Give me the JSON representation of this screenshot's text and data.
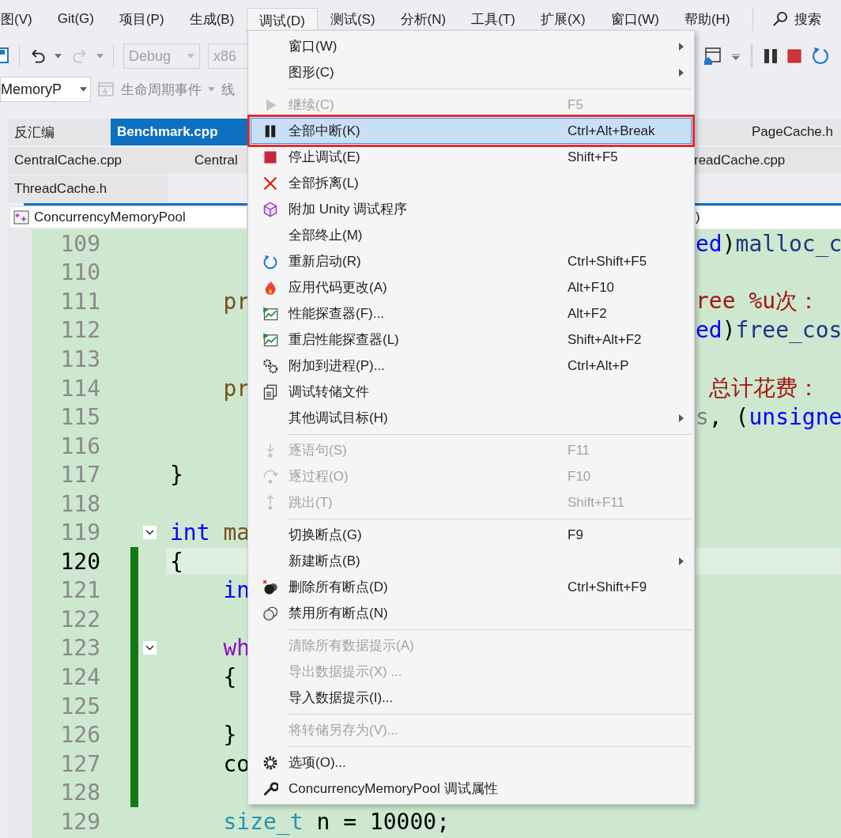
{
  "menu_bar": [
    {
      "label": "图(V)",
      "selected": false
    },
    {
      "label": "Git(G)",
      "selected": false
    },
    {
      "label": "项目(P)",
      "selected": false
    },
    {
      "label": "生成(B)",
      "selected": false
    },
    {
      "label": "调试(D)",
      "selected": true
    },
    {
      "label": "测试(S)",
      "selected": false
    },
    {
      "label": "分析(N)",
      "selected": false
    },
    {
      "label": "工具(T)",
      "selected": false
    },
    {
      "label": "扩展(X)",
      "selected": false
    },
    {
      "label": "窗口(W)",
      "selected": false
    },
    {
      "label": "帮助(H)",
      "selected": false
    }
  ],
  "search": {
    "label": "搜索"
  },
  "toolbar": {
    "configuration": "Debug",
    "platform": "x86"
  },
  "context_bar": {
    "project": "MemoryP",
    "lifecycle": "生命周期事件",
    "thread": "线"
  },
  "tab_rows": [
    {
      "left": [
        {
          "label": "反汇编",
          "selected": false
        },
        {
          "label": "Benchmark.cpp",
          "selected": true
        }
      ],
      "right": [
        {
          "label": "PageCache.h",
          "selected": false
        }
      ]
    },
    {
      "left": [
        {
          "label": "CentralCache.cpp",
          "selected": false
        },
        {
          "label": "Central",
          "selected": false
        }
      ],
      "right": [
        {
          "label": "readCache.cpp",
          "selected": false
        }
      ]
    },
    {
      "left": [
        {
          "label": "ThreadCache.h",
          "selected": false
        }
      ]
    }
  ],
  "nav_bar": {
    "scope": "ConcurrencyMemoryPool",
    "member": ")"
  },
  "lines": [
    {
      "number": "109",
      "current": false,
      "changed": false,
      "foldable": false,
      "right": [
        {
          "text": "ed",
          "kind": "keyword"
        },
        {
          "text": ")",
          "kind": "plain"
        },
        {
          "text": "malloc_c",
          "kind": "variable"
        }
      ]
    },
    {
      "number": "110",
      "current": false,
      "changed": false,
      "foldable": false
    },
    {
      "number": "111",
      "current": false,
      "changed": false,
      "foldable": false,
      "left": [
        {
          "text": "    pr",
          "kind": "function"
        }
      ],
      "right": [
        {
          "text": "ree %u次：",
          "kind": "string"
        }
      ]
    },
    {
      "number": "112",
      "current": false,
      "changed": false,
      "foldable": false,
      "right": [
        {
          "text": "ed",
          "kind": "keyword"
        },
        {
          "text": ")",
          "kind": "plain"
        },
        {
          "text": "free_cos",
          "kind": "variable"
        }
      ]
    },
    {
      "number": "113",
      "current": false,
      "changed": false,
      "foldable": false
    },
    {
      "number": "114",
      "current": false,
      "changed": false,
      "foldable": false,
      "left": [
        {
          "text": "    pr",
          "kind": "function"
        }
      ],
      "right": [
        {
          "text": " 总计花费：",
          "kind": "string"
        }
      ]
    },
    {
      "number": "115",
      "current": false,
      "changed": false,
      "foldable": false,
      "right": [
        {
          "text": "s",
          "kind": "param"
        },
        {
          "text": ", (",
          "kind": "plain"
        },
        {
          "text": "unsigne",
          "kind": "keyword"
        }
      ]
    },
    {
      "number": "116",
      "current": false,
      "changed": false,
      "foldable": false
    },
    {
      "number": "117",
      "current": false,
      "changed": false,
      "foldable": false,
      "left": [
        {
          "text": "}",
          "kind": "plain"
        }
      ]
    },
    {
      "number": "118",
      "current": false,
      "changed": false,
      "foldable": false
    },
    {
      "number": "119",
      "current": false,
      "changed": false,
      "foldable": true,
      "left": [
        {
          "text": "int",
          "kind": "keyword"
        },
        {
          "text": " ma",
          "kind": "function"
        }
      ]
    },
    {
      "number": "120",
      "current": true,
      "changed": true,
      "foldable": false,
      "left": [
        {
          "text": "{",
          "kind": "plain"
        }
      ]
    },
    {
      "number": "121",
      "current": false,
      "changed": true,
      "foldable": false,
      "left": [
        {
          "text": "    in",
          "kind": "keyword"
        }
      ]
    },
    {
      "number": "122",
      "current": false,
      "changed": true,
      "foldable": false
    },
    {
      "number": "123",
      "current": false,
      "changed": true,
      "foldable": true,
      "left": [
        {
          "text": "    wh",
          "kind": "control"
        }
      ]
    },
    {
      "number": "124",
      "current": false,
      "changed": true,
      "foldable": false,
      "left": [
        {
          "text": "    {",
          "kind": "plain"
        }
      ]
    },
    {
      "number": "125",
      "current": false,
      "changed": true,
      "foldable": false
    },
    {
      "number": "126",
      "current": false,
      "changed": true,
      "foldable": false,
      "left": [
        {
          "text": "    }",
          "kind": "plain"
        }
      ]
    },
    {
      "number": "127",
      "current": false,
      "changed": true,
      "foldable": false,
      "left": [
        {
          "text": "    co",
          "kind": "plain"
        }
      ]
    },
    {
      "number": "128",
      "current": false,
      "changed": true,
      "foldable": false
    },
    {
      "number": "129",
      "current": false,
      "changed": false,
      "foldable": false,
      "left": [
        {
          "text": "    size_t",
          "kind": "type"
        },
        {
          "text": " n = 10000;",
          "kind": "plain"
        }
      ]
    }
  ],
  "menu": [
    {
      "kind": "item",
      "label": "窗口(W)",
      "disabled": false,
      "submenu": true,
      "selected": false
    },
    {
      "kind": "item",
      "label": "图形(C)",
      "disabled": false,
      "submenu": true,
      "selected": false
    },
    {
      "kind": "separator"
    },
    {
      "kind": "item",
      "label": "继续(C)",
      "shortcut": "F5",
      "disabled": true,
      "submenu": false,
      "selected": false
    },
    {
      "kind": "item",
      "label": "全部中断(K)",
      "shortcut": "Ctrl+Alt+Break",
      "disabled": false,
      "submenu": false,
      "selected": true
    },
    {
      "kind": "item",
      "label": "停止调试(E)",
      "shortcut": "Shift+F5",
      "disabled": false,
      "submenu": false,
      "selected": false
    },
    {
      "kind": "item",
      "label": "全部拆离(L)",
      "disabled": false,
      "submenu": false,
      "selected": false
    },
    {
      "kind": "item",
      "label": "附加 Unity 调试程序",
      "disabled": false,
      "submenu": false,
      "selected": false
    },
    {
      "kind": "item",
      "label": "全部终止(M)",
      "disabled": false,
      "submenu": false,
      "selected": false
    },
    {
      "kind": "item",
      "label": "重新启动(R)",
      "shortcut": "Ctrl+Shift+F5",
      "disabled": false,
      "submenu": false,
      "selected": false
    },
    {
      "kind": "item",
      "label": "应用代码更改(A)",
      "shortcut": "Alt+F10",
      "disabled": false,
      "submenu": false,
      "selected": false
    },
    {
      "kind": "item",
      "label": "性能探查器(F)...",
      "shortcut": "Alt+F2",
      "disabled": false,
      "submenu": false,
      "selected": false
    },
    {
      "kind": "item",
      "label": "重启性能探查器(L)",
      "shortcut": "Shift+Alt+F2",
      "disabled": false,
      "submenu": false,
      "selected": false
    },
    {
      "kind": "item",
      "label": "附加到进程(P)...",
      "shortcut": "Ctrl+Alt+P",
      "disabled": false,
      "submenu": false,
      "selected": false
    },
    {
      "kind": "item",
      "label": "调试转储文件",
      "disabled": false,
      "submenu": false,
      "selected": false
    },
    {
      "kind": "item",
      "label": "其他调试目标(H)",
      "disabled": false,
      "submenu": true,
      "selected": false
    },
    {
      "kind": "separator"
    },
    {
      "kind": "item",
      "label": "逐语句(S)",
      "shortcut": "F11",
      "disabled": true,
      "submenu": false,
      "selected": false
    },
    {
      "kind": "item",
      "label": "逐过程(O)",
      "shortcut": "F10",
      "disabled": true,
      "submenu": false,
      "selected": false
    },
    {
      "kind": "item",
      "label": "跳出(T)",
      "shortcut": "Shift+F11",
      "disabled": true,
      "submenu": false,
      "selected": false
    },
    {
      "kind": "separator"
    },
    {
      "kind": "item",
      "label": "切换断点(G)",
      "shortcut": "F9",
      "disabled": false,
      "submenu": false,
      "selected": false
    },
    {
      "kind": "item",
      "label": "新建断点(B)",
      "disabled": false,
      "submenu": true,
      "selected": false
    },
    {
      "kind": "item",
      "label": "删除所有断点(D)",
      "shortcut": "Ctrl+Shift+F9",
      "disabled": false,
      "submenu": false,
      "selected": false
    },
    {
      "kind": "item",
      "label": "禁用所有断点(N)",
      "disabled": false,
      "submenu": false,
      "selected": false
    },
    {
      "kind": "separator"
    },
    {
      "kind": "item",
      "label": "清除所有数据提示(A)",
      "disabled": true,
      "submenu": false,
      "selected": false
    },
    {
      "kind": "item",
      "label": "导出数据提示(X) ...",
      "disabled": true,
      "submenu": false,
      "selected": false
    },
    {
      "kind": "item",
      "label": "导入数据提示(I)...",
      "disabled": false,
      "submenu": false,
      "selected": false
    },
    {
      "kind": "separator"
    },
    {
      "kind": "item",
      "label": "将转储另存为(V)...",
      "disabled": true,
      "submenu": false,
      "selected": false
    },
    {
      "kind": "separator"
    },
    {
      "kind": "item",
      "label": "选项(O)...",
      "disabled": false,
      "submenu": false,
      "selected": false
    },
    {
      "kind": "item",
      "label": "ConcurrencyMemoryPool 调试属性",
      "disabled": false,
      "submenu": false,
      "selected": false
    }
  ]
}
